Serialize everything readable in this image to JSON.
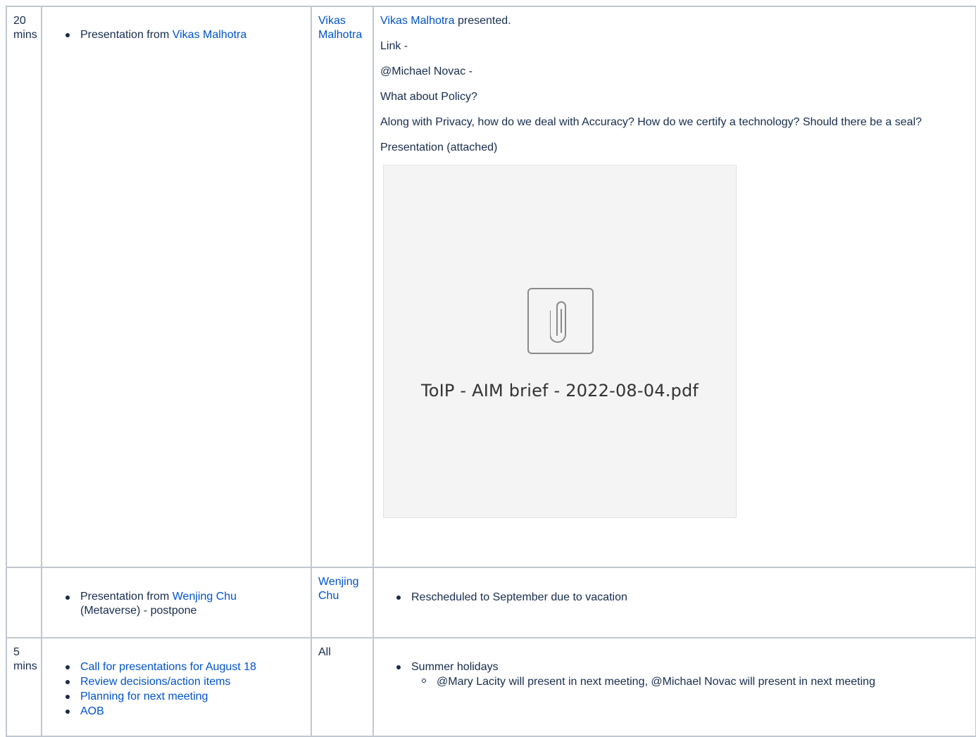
{
  "rows": [
    {
      "time": "20 mins",
      "item_prefix": "Presentation from ",
      "item_link": "Vikas Malhotra",
      "who": "Vikas Malhotra",
      "notes": {
        "presenter_link": "Vikas Malhotra",
        "presenter_suffix": " presented.",
        "link_line": "Link -",
        "mention_line": "@Michael Novac -",
        "policy_line": "What about Policy?",
        "question_line": "Along with Privacy, how do we deal with Accuracy? How do we certify a technology? Should there be a seal?",
        "presentation_line": "Presentation (attached)",
        "attachment_name": "ToIP - AIM brief - 2022-08-04.pdf",
        "attachment_icon": "paperclip-icon"
      }
    },
    {
      "time": "",
      "item_prefix": "Presentation from ",
      "item_link": "Wenjing Chu",
      "item_suffix": " (Metaverse) - postpone",
      "who": "Wenjing Chu",
      "note_bullet": "Rescheduled to September due to vacation"
    },
    {
      "time": "5 mins",
      "items": [
        "Call for presentations for August 18",
        "Review decisions/action items",
        "Planning for next meeting",
        "AOB"
      ],
      "who": "All",
      "note_bullet": "Summer holidays",
      "note_sub_bullet": "@Mary Lacity will present in next meeting, @Michael Novac will present in next meeting"
    }
  ],
  "colors": {
    "link": "#0052cc",
    "text": "#172b4d",
    "border": "#c1c7d0"
  }
}
